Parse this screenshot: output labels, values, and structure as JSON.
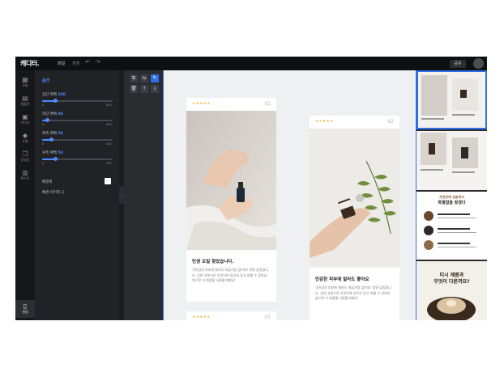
{
  "app": {
    "logo": "캐디터.",
    "menu_primary": "파일",
    "menu_secondary": "저장",
    "undo_icon": "undo-icon",
    "redo_icon": "redo-icon",
    "save_label": "공유"
  },
  "rail": [
    {
      "label": "모듈",
      "icon": "grid-icon"
    },
    {
      "label": "템플릿",
      "icon": "layers-icon"
    },
    {
      "label": "이미지",
      "icon": "image-icon"
    },
    {
      "label": "도형",
      "icon": "shapes-icon"
    },
    {
      "label": "동영상",
      "icon": "copy-icon"
    },
    {
      "label": "텍스트",
      "icon": "text-icon"
    },
    {
      "label": "설정",
      "icon": "document-icon"
    }
  ],
  "panel": {
    "title": "옵션",
    "sliders": [
      {
        "label": "상단 여백",
        "value": "100",
        "min": "0",
        "max": "600",
        "fraction": 0.19
      },
      {
        "label": "하단 여백",
        "value": "40",
        "min": "0",
        "max": "600",
        "fraction": 0.08
      },
      {
        "label": "좌측 여백",
        "value": "50",
        "min": "0",
        "max": "400",
        "fraction": 0.14
      },
      {
        "label": "우측 여백",
        "value": "50",
        "min": "0",
        "max": "300",
        "fraction": 0.19
      }
    ],
    "bg_color_label": "배경색",
    "bg_color": "#ffffff",
    "bg_image_label": "배경 이미지",
    "bg_image_action": "끔"
  },
  "toolbar": {
    "icons": [
      "crop-icon",
      "swap-icon",
      "pencil-icon",
      "trash-icon",
      "arrow-up-icon",
      "arrow-down-icon"
    ]
  },
  "cards": [
    {
      "stars": "★★★★★",
      "number": "01",
      "title": "민생 오일 찾았습니다.",
      "body": "극민감성 피부에 발라도 따끔거림 없어요! 정말 감동합니다. 순한 성분으로 이루어져 있어서 믿고 바를 수 있어요. 앞으로 더 애용할 사용할거예요!"
    },
    {
      "stars": "★★★★★",
      "number": "02",
      "title": "민감한 피부에 발라도 좋아요",
      "body": "극민감성 피부에 발라도 따끔거림 없어요! 정말 감동합니다. 순한 성분으로 이루어져 있어서 믿고 바를 수 있어요. 앞으로 더 애용할 사용할거예요!"
    },
    {
      "stars": "★★★★★",
      "number": "03"
    }
  ],
  "thumbs": {
    "section_title_1": "자연유래 성분에서",
    "section_title_2": "특별함을 찾겠다",
    "section_title_3": "티시 제품과",
    "section_title_4": "무엇이 다른까요?"
  },
  "colors": {
    "accent": "#2f6fe6",
    "slider": "#4f8bff",
    "star": "#f2b43a"
  }
}
